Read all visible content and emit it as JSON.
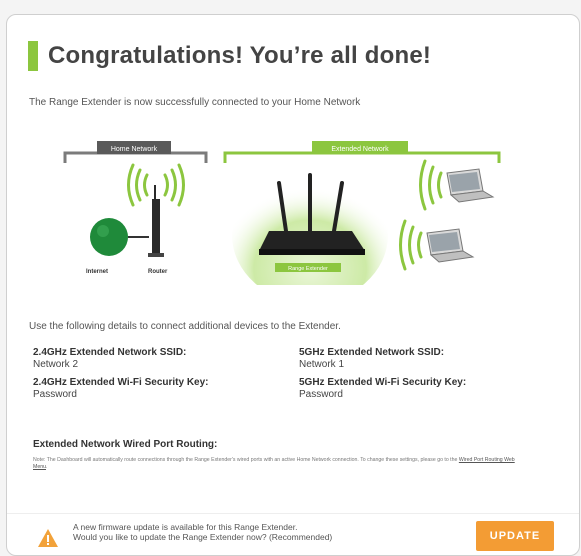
{
  "page": {
    "title": "Congratulations! You’re all done!",
    "subtitle": "The Range Extender is now successfully connected to your Home Network"
  },
  "diagram": {
    "home_network_label": "Home Network",
    "extended_network_label": "Extended Network",
    "internet_label": "Internet",
    "router_label": "Router",
    "extender_label": "Range Extender"
  },
  "details": {
    "instructions": "Use the following details to connect additional devices to the Extender.",
    "ssid_24_label": "2.4GHz Extended Network SSID:",
    "ssid_24_value": "Network 2",
    "key_24_label": "2.4GHz Extended Wi-Fi Security Key:",
    "key_24_value": "Password",
    "ssid_5_label": "5GHz Extended Network SSID:",
    "ssid_5_value": "Network 1",
    "key_5_label": "5GHz Extended Wi-Fi Security Key:",
    "key_5_value": "Password"
  },
  "routing": {
    "title": "Extended Network Wired Port Routing:",
    "note": "Note: The Dashboard will automatically route connections through the Range Extender's wired ports with an active Home Network connection. To change these settings, please go to the",
    "link": "Wired Port Routing Web Menu"
  },
  "firmware": {
    "line1": "A new firmware update is available for this Range Extender.",
    "line2": "Would you like to update the Range Extender now? (Recommended)",
    "button": "UPDATE"
  },
  "colors": {
    "accent_green": "#8cc63f",
    "router_green": "#1f8a3a",
    "dark_label": "#5a5a5a",
    "orange": "#f39c34",
    "warning": "#f2a23a"
  }
}
